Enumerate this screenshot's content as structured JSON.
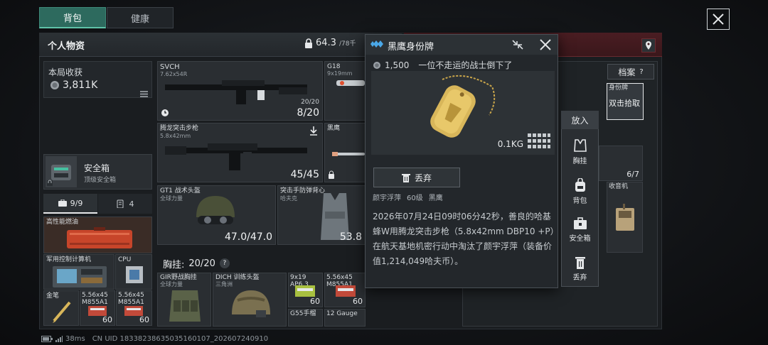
{
  "tabs": [
    {
      "label": "背包",
      "active": true
    },
    {
      "label": "健康",
      "active": false
    }
  ],
  "personal": {
    "title": "个人物资",
    "weight": "64.3",
    "weight_cap": "/78千",
    "session_label": "本局收获",
    "session_value": "3,811K"
  },
  "safe_box": {
    "title": "安全箱",
    "subtitle": "顶级安全箱"
  },
  "sub_tabs": [
    {
      "label": "9/9",
      "icon": "case-icon"
    },
    {
      "label": "4",
      "icon": "list-icon"
    }
  ],
  "weapons": [
    {
      "name": "SVCH",
      "ammo": "7.62x54R",
      "mag": "20/20",
      "count": "8/20"
    },
    {
      "name": "G18",
      "ammo": "9x19mm"
    },
    {
      "name": "腾龙突击步枪",
      "ammo": "5.8x42mm",
      "count": "45/45"
    },
    {
      "name": "黑鹰"
    }
  ],
  "gear": [
    {
      "name": "GT1 战术头盔",
      "sub": "全球力量",
      "durability": "47.0/47.0"
    },
    {
      "name": "突击手防弹背心",
      "sub": "哈夫克",
      "durability": "53.8"
    }
  ],
  "chest_rig": {
    "label": "胸挂:",
    "value": "20/20",
    "help": "?"
  },
  "rig_items": [
    {
      "name": "GIR野战胸挂",
      "sub": "全球力量"
    },
    {
      "name": "DICH 训练头盔",
      "sub": "三角洲"
    },
    {
      "name": "9x19",
      "sub": "AP6.3",
      "count": "60"
    },
    {
      "name": "5.56x45",
      "sub": "M855A1",
      "count": "60"
    },
    {
      "name": "G55手榴",
      "sub": ""
    },
    {
      "name": "12 Gauge",
      "sub": "",
      "count": ""
    }
  ],
  "safe_items": [
    {
      "name": "高性能燃油"
    },
    {
      "name": "军用控制计算机"
    },
    {
      "name": "CPU"
    },
    {
      "name": "金笔"
    },
    {
      "name": "5.56x45",
      "sub": "M855A1",
      "count": "60"
    },
    {
      "name": "5.56x45",
      "sub": "M855A1",
      "count": "60"
    }
  ],
  "popup": {
    "title": "黑鹰身份牌",
    "price": "1,500",
    "tagline": "一位不走运的战士倒下了",
    "weight": "0.1KG",
    "discard": "丢弃",
    "owner_name": "颜宇浮萍",
    "owner_level": "60级",
    "owner_faction": "黑鹰",
    "description": "2026年07月24日09时06分42秒，善良的哈基蜂W用腾龙突击步枪（5.8x42mm DBP10 +P）在航天基地机密行动中淘汰了颜宇浮萍（装备价值1,214,049哈夫币）。"
  },
  "side_menu": [
    {
      "label": "放入",
      "icon": ""
    },
    {
      "label": "胸挂",
      "icon": "vest-icon"
    },
    {
      "label": "背包",
      "icon": "backpack-icon"
    },
    {
      "label": "安全箱",
      "icon": "safebox-icon"
    },
    {
      "label": "丢弃",
      "icon": "trash-icon"
    }
  ],
  "loot": {
    "archive_label": "档案",
    "archive_help": "?",
    "dogtag_label": "身份牌",
    "pickup_hint": "双击拾取",
    "radio_label": "收音机",
    "count": "6/7"
  },
  "status": {
    "latency": "38ms",
    "uid": "CN UID 18338238635035160107_202607240910"
  },
  "colors": {
    "accent": "#2d6a5e",
    "enemy": "#4a1d22",
    "gold": "#d8b65a"
  }
}
